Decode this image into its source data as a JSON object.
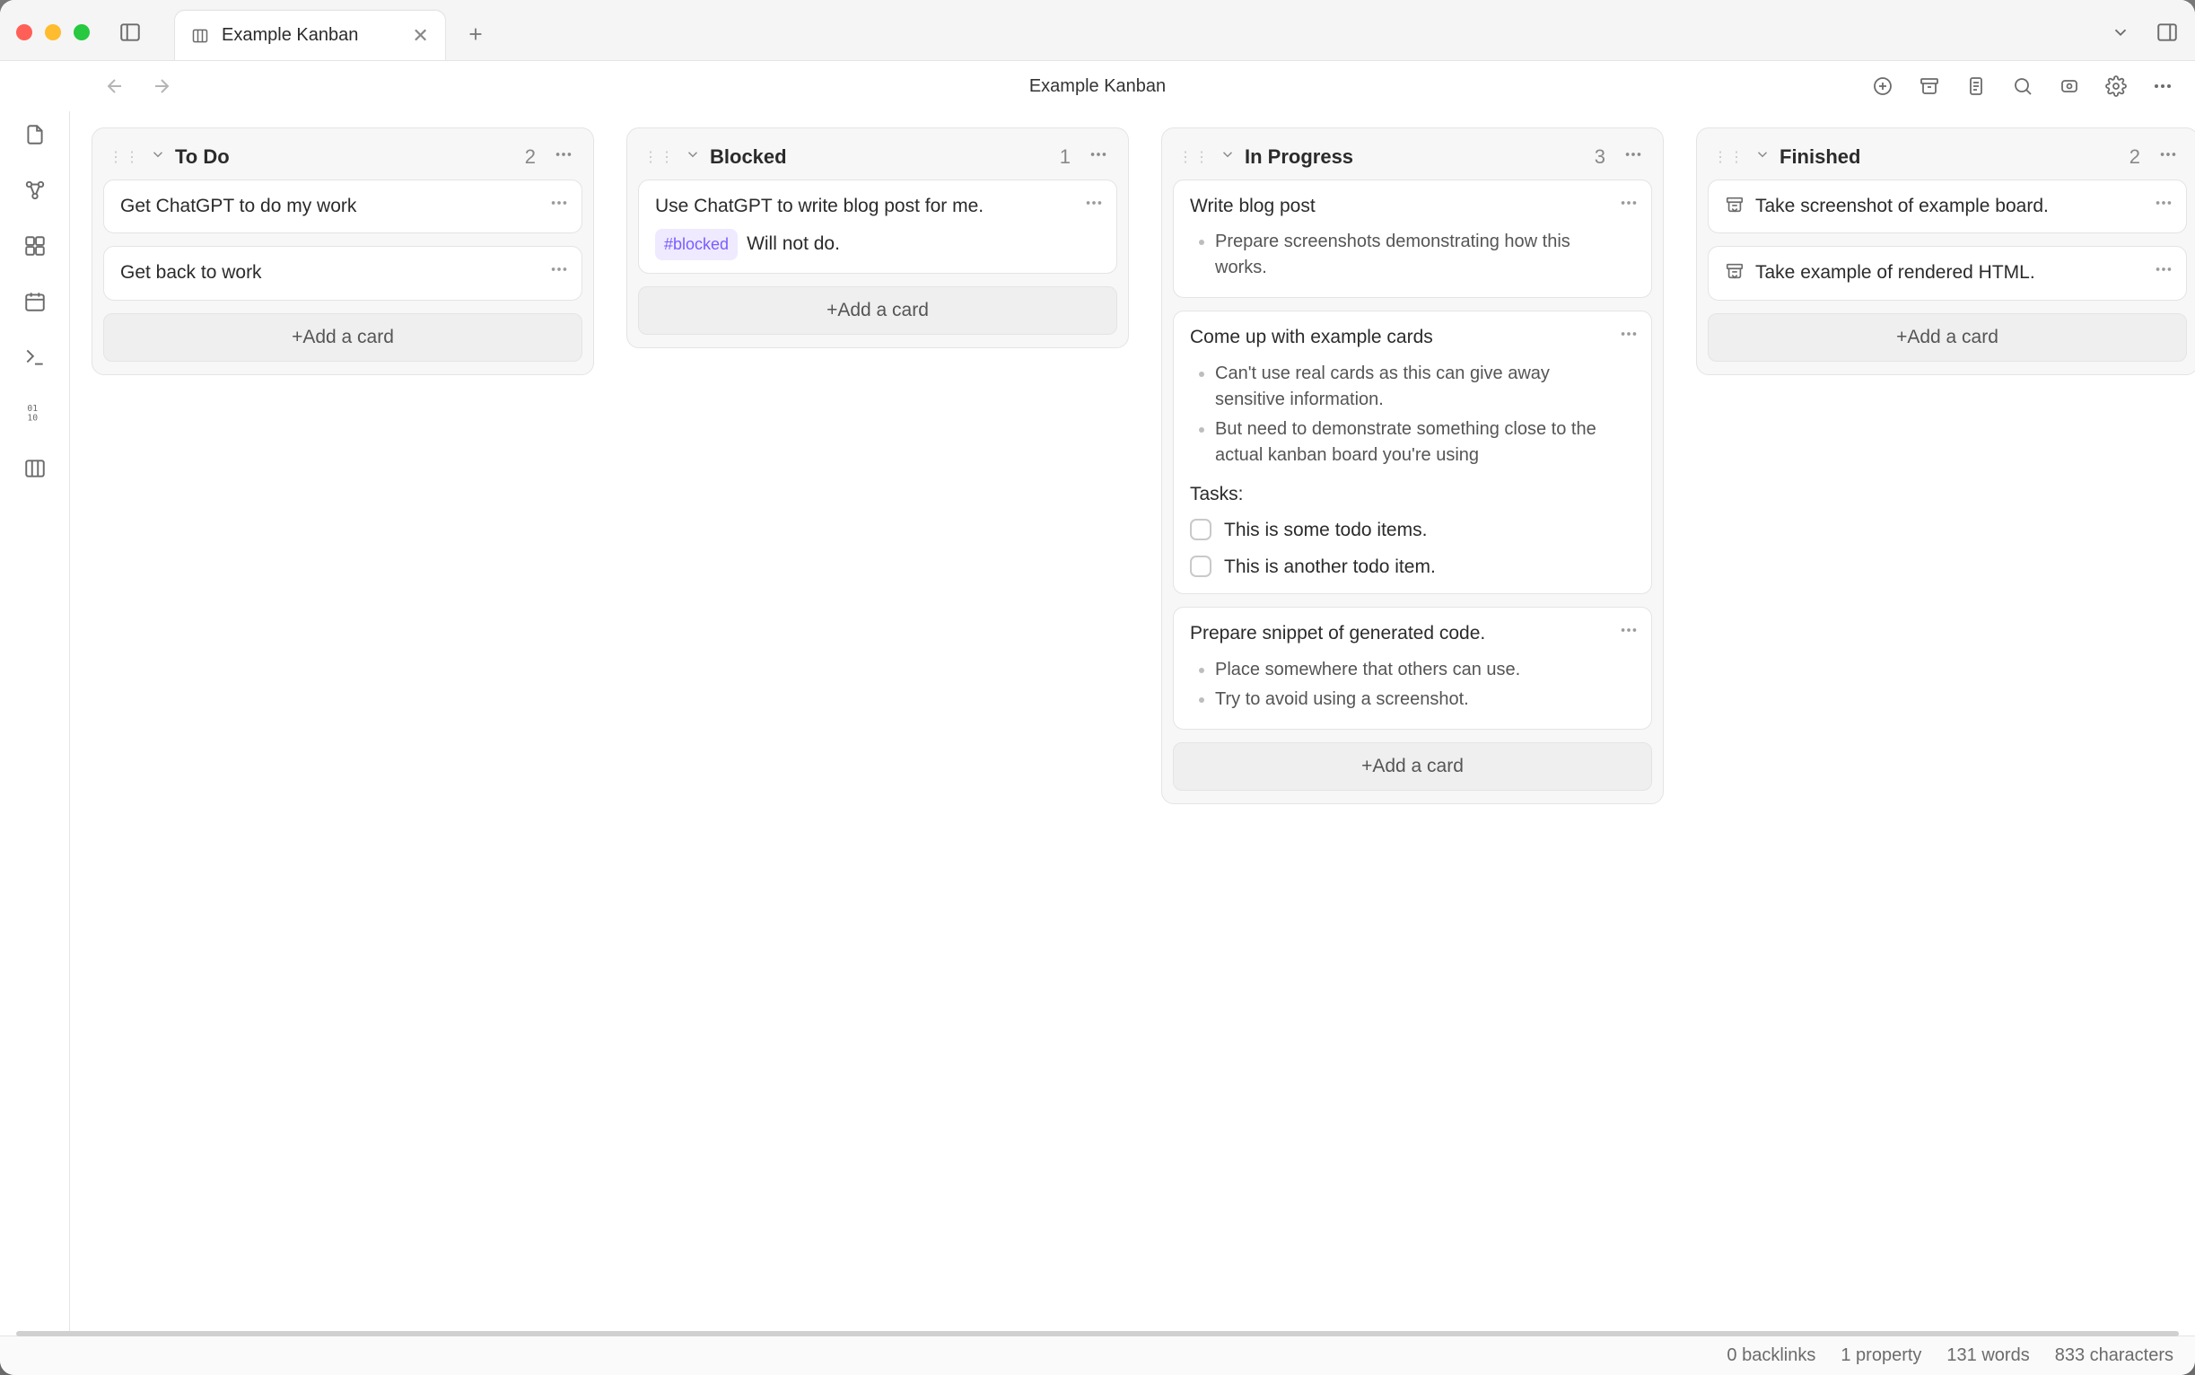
{
  "tab": {
    "label": "Example Kanban"
  },
  "doc_title": "Example Kanban",
  "add_card_label": "+Add a card",
  "columns": [
    {
      "title": "To Do",
      "count": "2",
      "cards": [
        {
          "title": "Get ChatGPT to do my work"
        },
        {
          "title": "Get back to work"
        }
      ]
    },
    {
      "title": "Blocked",
      "count": "1",
      "cards": [
        {
          "title": "Use ChatGPT to write blog post for me.",
          "tag": "#blocked",
          "note": "Will not do."
        }
      ]
    },
    {
      "title": "In Progress",
      "count": "3",
      "cards": [
        {
          "title": "Write blog post",
          "bullets": [
            "Prepare screenshots demonstrating how this works."
          ]
        },
        {
          "title": "Come up with example cards",
          "bullets": [
            "Can't use real cards as this can give away sensitive information.",
            "But need to demonstrate something close to the actual kanban board you're using"
          ],
          "tasks_label": "Tasks:",
          "todos": [
            "This is some todo items.",
            "This is another todo item."
          ]
        },
        {
          "title": "Prepare snippet of generated code.",
          "bullets": [
            "Place somewhere that others can use.",
            "Try to avoid using a screenshot."
          ]
        }
      ]
    },
    {
      "title": "Finished",
      "count": "2",
      "cards": [
        {
          "title": "Take screenshot of example board.",
          "prefix_icon": "archive"
        },
        {
          "title": "Take example of rendered HTML.",
          "prefix_icon": "archive"
        }
      ]
    }
  ],
  "status": {
    "backlinks": "0 backlinks",
    "properties": "1 property",
    "words": "131 words",
    "chars": "833 characters"
  }
}
